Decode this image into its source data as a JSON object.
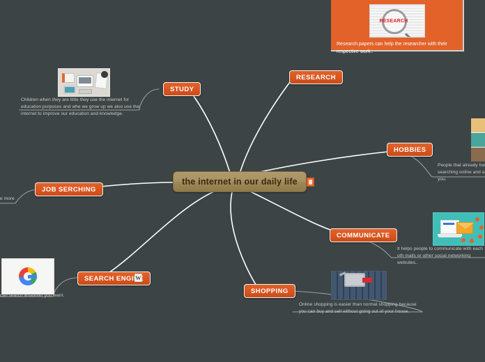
{
  "mindmap": {
    "center": {
      "label": "the internet in our daily life",
      "badge_icon": "orange-square-icon"
    },
    "background_color": "#3d4446",
    "branch_color": "#d9551f",
    "branches": [
      {
        "id": "study",
        "label": "STUDY",
        "caption": "Children when they are little they use the internet for education purposes and whe we grow up we also use the internet to improve our education and knowledge.",
        "image_name": "study-desk-image"
      },
      {
        "id": "research",
        "label": "RESEARCH",
        "caption": "Research papers can help the researcher with their respective work..",
        "image_name": "research-magnifier-image",
        "panel_color": "#e2622a"
      },
      {
        "id": "hobbies",
        "label": "HOBBIES",
        "caption": "People that already have searching online and als you.",
        "image_name": "hobbies-collage-image"
      },
      {
        "id": "communicate",
        "label": "COMMUNICATE",
        "caption": "It helps people to communicate with each oth mails or other social networking websites..",
        "image_name": "communicate-laptop-mail-image"
      },
      {
        "id": "shopping",
        "label": "SHOPPING",
        "caption": "Online shopping is easier than normal shopping because you can buy and sell without going out of your house.",
        "image_name": "shopping-cart-keyboard-image"
      },
      {
        "id": "search-engine",
        "label": "SEARCH ENGINE",
        "caption": "can search whatever you want.",
        "image_name": "google-logo-image",
        "badge_label": "W"
      },
      {
        "id": "job-serching",
        "label": "JOB SERCHING",
        "caption": "e more",
        "image_name": ""
      }
    ]
  }
}
